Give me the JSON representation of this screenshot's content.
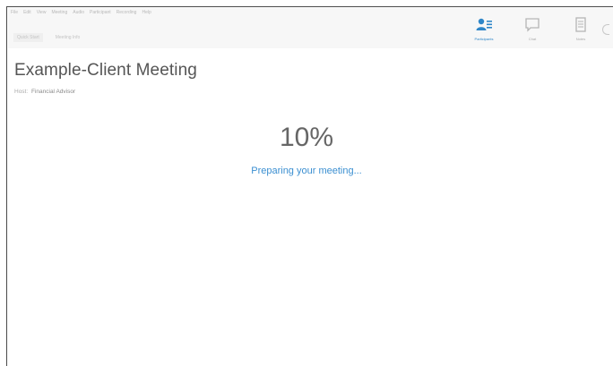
{
  "menu": {
    "items": [
      "File",
      "Edit",
      "View",
      "Meeting",
      "Audio",
      "Participant",
      "Recording",
      "Help"
    ]
  },
  "tabs": [
    {
      "label": "Quick Start"
    },
    {
      "label": "Meeting Info"
    }
  ],
  "toolbar": {
    "participants_label": "Participants",
    "chat_label": "Chat",
    "notes_label": "Notes",
    "accent_color": "#2f86c8"
  },
  "meeting": {
    "title": "Example-Client Meeting",
    "host_key": "Host:",
    "host_value": "Financial Advisor"
  },
  "progress": {
    "percent_text": "10%",
    "value": 0.1,
    "status": "Preparing your meeting..."
  }
}
